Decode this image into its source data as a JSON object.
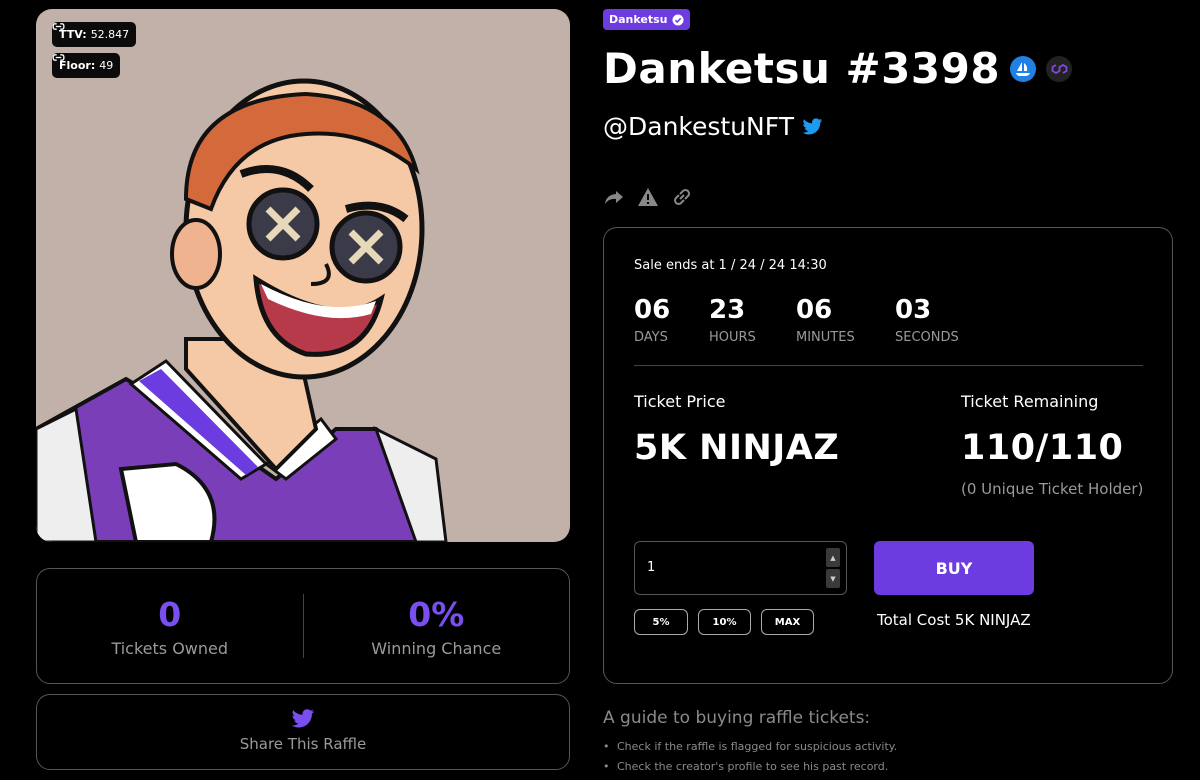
{
  "nft": {
    "ttv_label": "TTV:",
    "ttv_value": "52.847",
    "floor_label": "Floor:",
    "floor_value": "49"
  },
  "stats": {
    "tickets_owned_value": "0",
    "tickets_owned_label": "Tickets Owned",
    "winning_chance_value": "0%",
    "winning_chance_label": "Winning Chance"
  },
  "share": {
    "label": "Share This Raffle"
  },
  "header": {
    "collection": "Danketsu",
    "title": "Danketsu #3398",
    "handle": "@DankestuNFT"
  },
  "sale": {
    "ends_text": "Sale ends at 1 / 24 / 24 14:30",
    "countdown": [
      {
        "value": "06",
        "label": "DAYS"
      },
      {
        "value": "23",
        "label": "HOURS"
      },
      {
        "value": "06",
        "label": "MINUTES"
      },
      {
        "value": "03",
        "label": "SECONDS"
      }
    ],
    "ticket_price_label": "Ticket Price",
    "ticket_price_value": "5K NINJAZ",
    "ticket_remaining_label": "Ticket Remaining",
    "ticket_remaining_value": "110/110",
    "unique_holders": "(0 Unique Ticket Holder)",
    "quantity": "1",
    "buy_label": "BUY",
    "pct_buttons": [
      "5%",
      "10%",
      "MAX"
    ],
    "total_cost": "Total Cost 5K NINJAZ"
  },
  "guide": {
    "title": "A guide to buying raffle tickets:",
    "items": [
      "Check if the raffle is flagged for suspicious activity.",
      "Check the creator's profile to see his past record."
    ]
  },
  "colors": {
    "accent": "#6d3ce0",
    "stat_purple": "#7a4ff0",
    "image_bg": "#c2b1a9",
    "twitter": "#1d9bf0"
  },
  "icons": [
    "link-icon",
    "verified-icon",
    "opensea-icon",
    "polygon-icon",
    "twitter-icon",
    "share-icon",
    "warning-icon"
  ]
}
